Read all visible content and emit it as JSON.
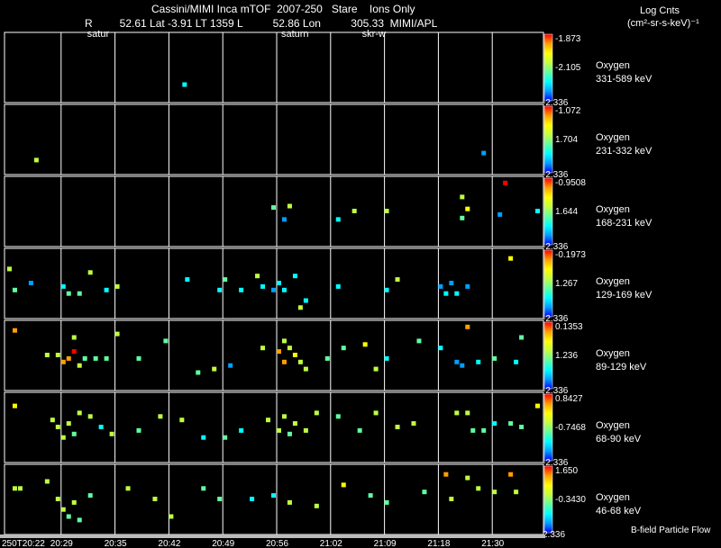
{
  "header": {
    "title": "Cassini/MIMI Inca mTOF  2007-250   Stare    Ions Only",
    "line2": "R         52.61 Lat -3.91 LT 1359 L          52.86 Lon          305.33  MIMI/APL",
    "units_line1": "Log Cnts",
    "units_line2": "(cm²-sr-s-keV)⁻¹"
  },
  "chart_data": {
    "type": "heatmap",
    "title": "Cassini/MIMI Inca mTOF  2007-250   Stare    Ions Only",
    "x_tick_labels": [
      "250T20:22",
      "20:29",
      "20:35",
      "20:42",
      "20:49",
      "20:56",
      "21:02",
      "21:09",
      "21:18",
      "21:30"
    ],
    "x_tick_fraction": [
      0.0,
      0.1,
      0.2,
      0.3,
      0.4,
      0.5,
      0.6,
      0.7,
      0.8,
      0.9
    ],
    "footer_label": "B-field Particle Flow",
    "event_labels": [
      {
        "text": "satur",
        "x_fraction": 0.16
      },
      {
        "text": "saturn",
        "x_fraction": 0.52
      },
      {
        "text": "skr-w",
        "x_fraction": 0.67
      }
    ],
    "colorscale": [
      "#0000ff",
      "#00a0ff",
      "#00ffff",
      "#60ffa0",
      "#c0ff40",
      "#ffff00",
      "#ffa000",
      "#ff0000"
    ],
    "panels": [
      {
        "species": "Oxygen",
        "energy": "331-589 keV",
        "cb_max": "-1.873",
        "cb_mid": "-2.105",
        "cb_min": "-2.336",
        "points": [
          [
            0.335,
            0.75,
            0.3
          ]
        ]
      },
      {
        "species": "Oxygen",
        "energy": "231-332 keV",
        "cb_max": "-1.072",
        "cb_mid": "1.704",
        "cb_min": "-2.336",
        "points": [
          [
            0.06,
            0.8,
            0.5
          ],
          [
            0.89,
            0.7,
            0.1
          ]
        ]
      },
      {
        "species": "Oxygen",
        "energy": "168-231 keV",
        "cb_max": "-0.9508",
        "cb_mid": "1.644",
        "cb_min": "-2.336",
        "points": [
          [
            0.5,
            0.45,
            0.4
          ],
          [
            0.53,
            0.43,
            0.6
          ],
          [
            0.52,
            0.62,
            0.2
          ],
          [
            0.62,
            0.62,
            0.3
          ],
          [
            0.65,
            0.5,
            0.6
          ],
          [
            0.71,
            0.5,
            0.5
          ],
          [
            0.85,
            0.3,
            0.5
          ],
          [
            0.85,
            0.6,
            0.4
          ],
          [
            0.93,
            0.1,
            0.95
          ],
          [
            0.92,
            0.55,
            0.1
          ],
          [
            0.99,
            0.5,
            0.3
          ],
          [
            0.86,
            0.47,
            0.7
          ]
        ]
      },
      {
        "species": "Oxygen",
        "energy": "129-169 keV",
        "cb_max": "-0.1973",
        "cb_mid": "1.267",
        "cb_min": "-2.336",
        "points": [
          [
            0.01,
            0.3,
            0.6
          ],
          [
            0.02,
            0.6,
            0.4
          ],
          [
            0.05,
            0.5,
            0.2
          ],
          [
            0.11,
            0.55,
            0.3
          ],
          [
            0.12,
            0.65,
            0.4
          ],
          [
            0.14,
            0.65,
            0.4
          ],
          [
            0.16,
            0.35,
            0.6
          ],
          [
            0.19,
            0.6,
            0.3
          ],
          [
            0.21,
            0.55,
            0.5
          ],
          [
            0.34,
            0.45,
            0.3
          ],
          [
            0.4,
            0.6,
            0.3
          ],
          [
            0.41,
            0.45,
            0.4
          ],
          [
            0.44,
            0.6,
            0.35
          ],
          [
            0.47,
            0.4,
            0.5
          ],
          [
            0.48,
            0.55,
            0.3
          ],
          [
            0.5,
            0.6,
            0.2
          ],
          [
            0.51,
            0.5,
            0.3
          ],
          [
            0.52,
            0.6,
            0.25
          ],
          [
            0.55,
            0.85,
            0.6
          ],
          [
            0.54,
            0.4,
            0.3
          ],
          [
            0.56,
            0.75,
            0.3
          ],
          [
            0.62,
            0.55,
            0.3
          ],
          [
            0.71,
            0.6,
            0.35
          ],
          [
            0.73,
            0.45,
            0.5
          ],
          [
            0.81,
            0.55,
            0.2
          ],
          [
            0.82,
            0.65,
            0.3
          ],
          [
            0.83,
            0.5,
            0.1
          ],
          [
            0.84,
            0.65,
            0.25
          ],
          [
            0.86,
            0.55,
            0.1
          ],
          [
            0.94,
            0.15,
            0.65
          ]
        ]
      },
      {
        "species": "Oxygen",
        "energy": "89-129 keV",
        "cb_max": "0.1353",
        "cb_mid": "1.236",
        "cb_min": "-2.336",
        "points": [
          [
            0.02,
            0.15,
            0.85
          ],
          [
            0.08,
            0.5,
            0.5
          ],
          [
            0.1,
            0.5,
            0.6
          ],
          [
            0.11,
            0.6,
            0.8
          ],
          [
            0.12,
            0.55,
            0.85
          ],
          [
            0.13,
            0.45,
            0.95
          ],
          [
            0.13,
            0.25,
            0.5
          ],
          [
            0.14,
            0.65,
            0.6
          ],
          [
            0.15,
            0.55,
            0.4
          ],
          [
            0.17,
            0.55,
            0.4
          ],
          [
            0.19,
            0.55,
            0.4
          ],
          [
            0.21,
            0.2,
            0.6
          ],
          [
            0.25,
            0.55,
            0.4
          ],
          [
            0.3,
            0.3,
            0.4
          ],
          [
            0.36,
            0.75,
            0.4
          ],
          [
            0.39,
            0.7,
            0.5
          ],
          [
            0.42,
            0.65,
            0.2
          ],
          [
            0.48,
            0.4,
            0.5
          ],
          [
            0.51,
            0.45,
            0.9
          ],
          [
            0.52,
            0.6,
            0.8
          ],
          [
            0.53,
            0.4,
            0.6
          ],
          [
            0.54,
            0.5,
            0.7
          ],
          [
            0.52,
            0.3,
            0.5
          ],
          [
            0.55,
            0.6,
            0.55
          ],
          [
            0.56,
            0.7,
            0.5
          ],
          [
            0.6,
            0.55,
            0.4
          ],
          [
            0.63,
            0.4,
            0.4
          ],
          [
            0.67,
            0.35,
            0.75
          ],
          [
            0.69,
            0.7,
            0.6
          ],
          [
            0.71,
            0.55,
            0.3
          ],
          [
            0.77,
            0.3,
            0.45
          ],
          [
            0.81,
            0.4,
            0.3
          ],
          [
            0.84,
            0.6,
            0.2
          ],
          [
            0.85,
            0.65,
            0.1
          ],
          [
            0.86,
            0.1,
            0.8
          ],
          [
            0.88,
            0.6,
            0.35
          ],
          [
            0.91,
            0.55,
            0.45
          ],
          [
            0.95,
            0.6,
            0.3
          ],
          [
            0.96,
            0.25,
            0.4
          ]
        ]
      },
      {
        "species": "Oxygen",
        "energy": "68-90 keV",
        "cb_max": "0.8427",
        "cb_mid": "-0.7468",
        "cb_min": "-2.336",
        "points": [
          [
            0.02,
            0.2,
            0.7
          ],
          [
            0.09,
            0.4,
            0.55
          ],
          [
            0.1,
            0.5,
            0.5
          ],
          [
            0.11,
            0.65,
            0.6
          ],
          [
            0.12,
            0.45,
            0.55
          ],
          [
            0.13,
            0.6,
            0.45
          ],
          [
            0.14,
            0.3,
            0.5
          ],
          [
            0.16,
            0.35,
            0.6
          ],
          [
            0.18,
            0.5,
            0.3
          ],
          [
            0.2,
            0.6,
            0.5
          ],
          [
            0.25,
            0.55,
            0.4
          ],
          [
            0.29,
            0.35,
            0.6
          ],
          [
            0.33,
            0.4,
            0.5
          ],
          [
            0.37,
            0.65,
            0.3
          ],
          [
            0.41,
            0.65,
            0.4
          ],
          [
            0.44,
            0.55,
            0.3
          ],
          [
            0.49,
            0.4,
            0.55
          ],
          [
            0.51,
            0.55,
            0.5
          ],
          [
            0.52,
            0.35,
            0.6
          ],
          [
            0.53,
            0.6,
            0.45
          ],
          [
            0.54,
            0.45,
            0.5
          ],
          [
            0.56,
            0.55,
            0.55
          ],
          [
            0.58,
            0.3,
            0.6
          ],
          [
            0.62,
            0.35,
            0.45
          ],
          [
            0.66,
            0.55,
            0.45
          ],
          [
            0.69,
            0.3,
            0.5
          ],
          [
            0.73,
            0.5,
            0.5
          ],
          [
            0.76,
            0.45,
            0.5
          ],
          [
            0.84,
            0.3,
            0.5
          ],
          [
            0.86,
            0.3,
            0.6
          ],
          [
            0.87,
            0.55,
            0.45
          ],
          [
            0.89,
            0.55,
            0.4
          ],
          [
            0.91,
            0.45,
            0.35
          ],
          [
            0.94,
            0.45,
            0.4
          ],
          [
            0.96,
            0.5,
            0.45
          ],
          [
            0.99,
            0.2,
            0.65
          ]
        ]
      },
      {
        "species": "Oxygen",
        "energy": "46-68 keV",
        "cb_max": "1.650",
        "cb_mid": "-0.3430",
        "cb_min": "2.336",
        "points": [
          [
            0.02,
            0.35,
            0.6
          ],
          [
            0.03,
            0.35,
            0.5
          ],
          [
            0.08,
            0.25,
            0.6
          ],
          [
            0.1,
            0.5,
            0.55
          ],
          [
            0.11,
            0.65,
            0.6
          ],
          [
            0.12,
            0.75,
            0.45
          ],
          [
            0.13,
            0.55,
            0.5
          ],
          [
            0.14,
            0.8,
            0.4
          ],
          [
            0.16,
            0.45,
            0.4
          ],
          [
            0.23,
            0.35,
            0.5
          ],
          [
            0.28,
            0.5,
            0.5
          ],
          [
            0.31,
            0.75,
            0.5
          ],
          [
            0.37,
            0.35,
            0.45
          ],
          [
            0.4,
            0.5,
            0.4
          ],
          [
            0.46,
            0.5,
            0.3
          ],
          [
            0.5,
            0.45,
            0.3
          ],
          [
            0.53,
            0.55,
            0.5
          ],
          [
            0.58,
            0.6,
            0.55
          ],
          [
            0.63,
            0.3,
            0.75
          ],
          [
            0.68,
            0.45,
            0.4
          ],
          [
            0.71,
            0.55,
            0.4
          ],
          [
            0.78,
            0.4,
            0.45
          ],
          [
            0.82,
            0.15,
            0.85
          ],
          [
            0.83,
            0.5,
            0.5
          ],
          [
            0.86,
            0.2,
            0.6
          ],
          [
            0.88,
            0.35,
            0.5
          ],
          [
            0.91,
            0.4,
            0.5
          ],
          [
            0.94,
            0.15,
            0.9
          ],
          [
            0.95,
            0.4,
            0.5
          ]
        ]
      }
    ]
  }
}
